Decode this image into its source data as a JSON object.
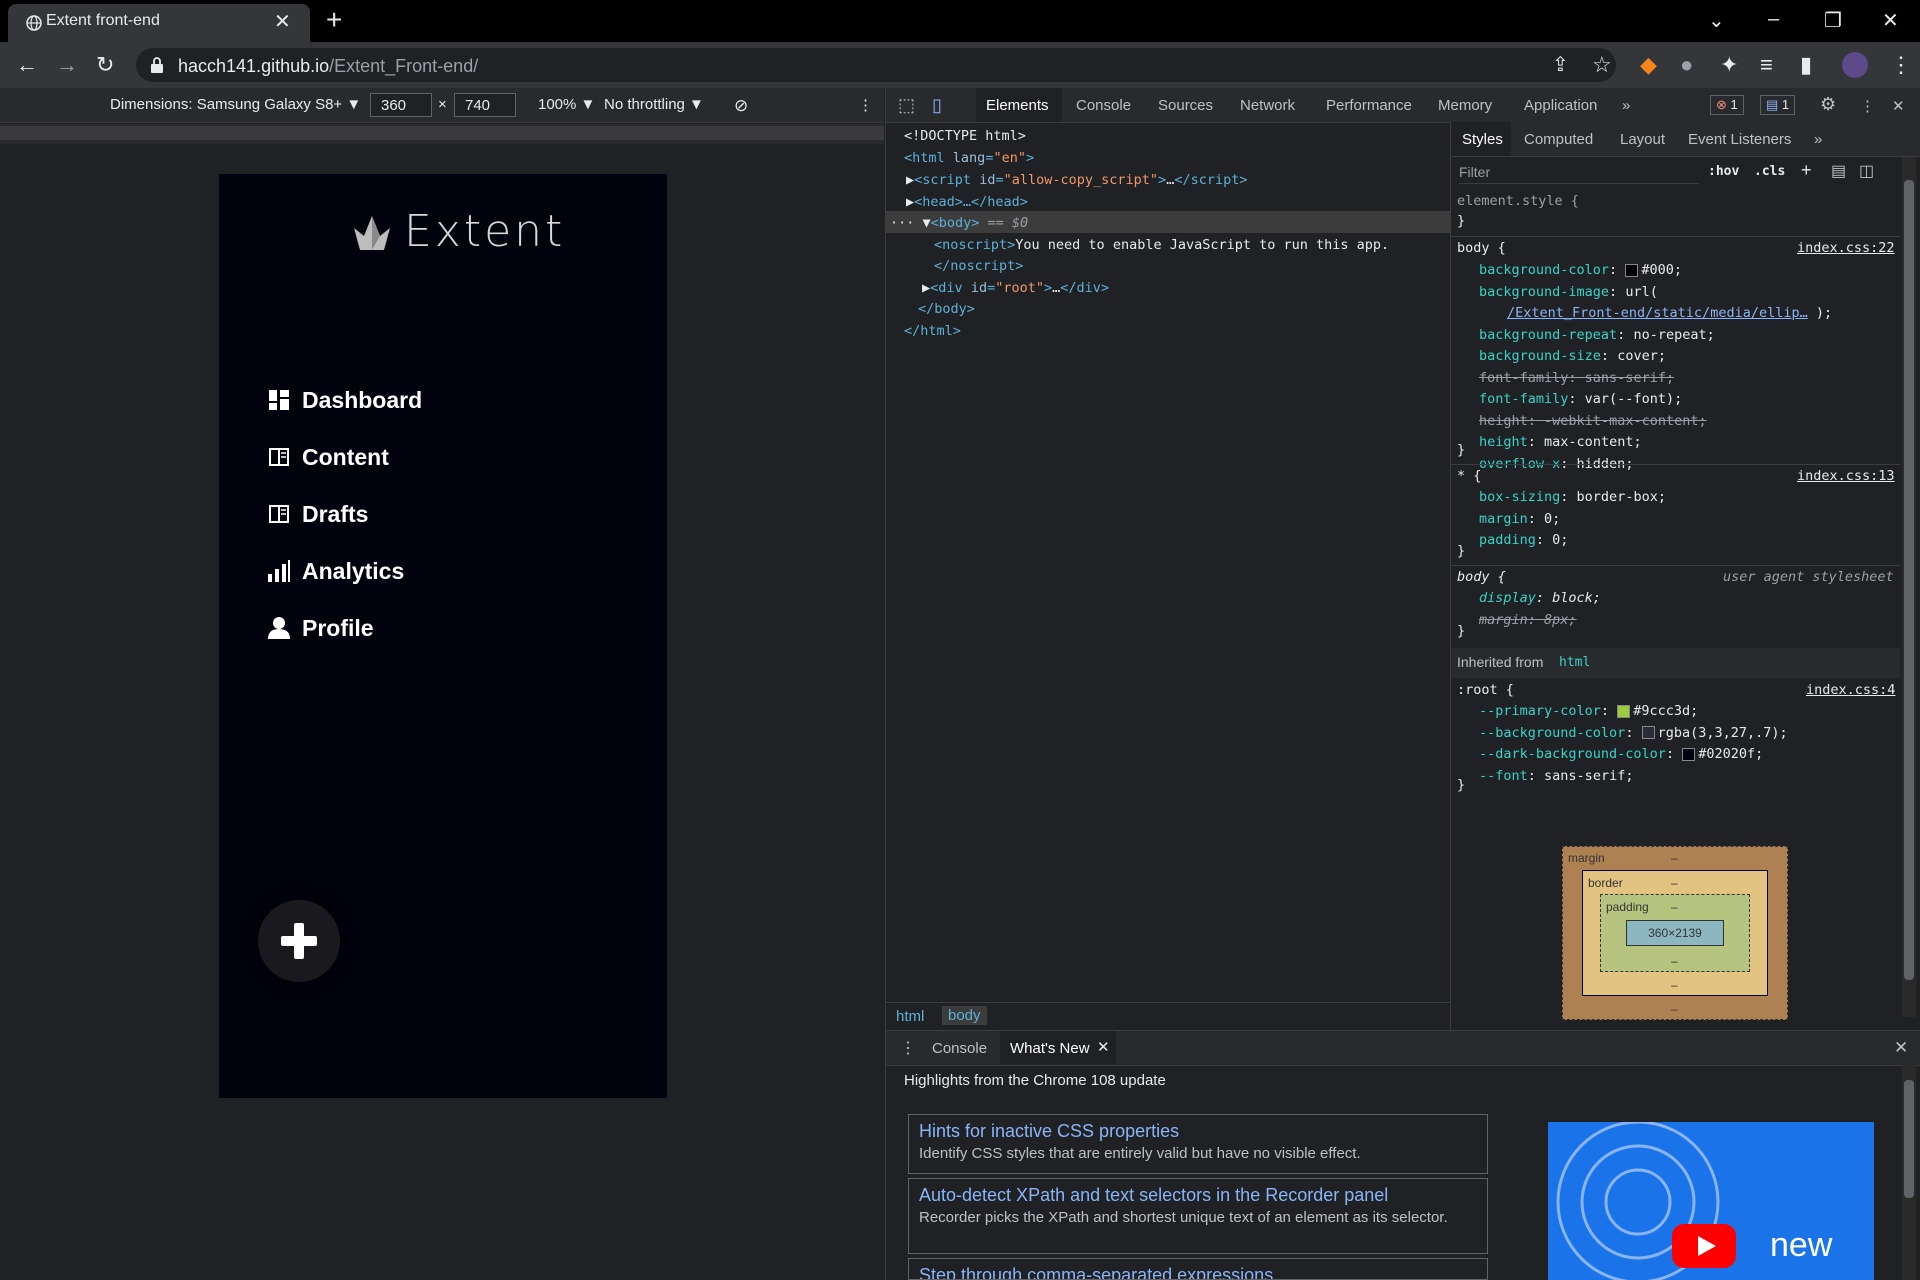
{
  "browser": {
    "tab_title": "Extent front-end",
    "url_host": "hacch141.github.io",
    "url_path": "/Extent_Front-end/"
  },
  "device_toolbar": {
    "dimensions_label": "Dimensions: Samsung Galaxy S8+",
    "width": "360",
    "height": "740",
    "zoom": "100%",
    "throttling": "No throttling"
  },
  "app": {
    "logo_text": "Extent",
    "nav": [
      {
        "label": "Dashboard",
        "icon": "dashboard-icon"
      },
      {
        "label": "Content",
        "icon": "book-icon"
      },
      {
        "label": "Drafts",
        "icon": "book-icon"
      },
      {
        "label": "Analytics",
        "icon": "bar-chart-icon"
      },
      {
        "label": "Profile",
        "icon": "user-icon"
      }
    ],
    "fab_icon": "plus-icon"
  },
  "devtools": {
    "tabs": [
      "Elements",
      "Console",
      "Sources",
      "Network",
      "Performance",
      "Memory",
      "Application"
    ],
    "active_tab": "Elements",
    "error_count": "1",
    "message_count": "1",
    "dom": {
      "doctype": "<!DOCTYPE html>",
      "html_open_tag": "html",
      "html_lang_attr": "lang",
      "html_lang_val": "\"en\"",
      "script_tag": "script",
      "script_id_attr": "id",
      "script_id_val": "\"allow-copy_script\"",
      "head": "<head>…</head>",
      "body_open": "<body>",
      "body_suffix": " == $0",
      "noscript_open": "<noscript>",
      "noscript_text": "You need to enable JavaScript to run this app.",
      "noscript_close": "</noscript>",
      "div_tag": "div",
      "div_id_attr": "id",
      "div_id_val": "\"root\"",
      "body_close": "</body>",
      "html_close": "</html>"
    },
    "breadcrumbs": [
      "html",
      "body"
    ],
    "styles_tabs": [
      "Styles",
      "Computed",
      "Layout",
      "Event Listeners"
    ],
    "filter_placeholder": "Filter",
    "hov": ":hov",
    "cls": ".cls",
    "rules": {
      "element_style": "element.style {",
      "body_selector": "body {",
      "body_source": "index.css:22",
      "body_props": [
        {
          "p": "background-color",
          "v": "#000;",
          "swatch": "#000000"
        },
        {
          "p": "background-image",
          "v": "url("
        },
        {
          "p": "",
          "v": "/Extent_Front-end/static/media/ellip…",
          "link": true
        },
        {
          "p": "background-repeat",
          "v": "no-repeat;"
        },
        {
          "p": "background-size",
          "v": "cover;"
        },
        {
          "p": "font-family",
          "v": "sans-serif;",
          "strike": true
        },
        {
          "p": "font-family",
          "v": "var(--font);"
        },
        {
          "p": "height",
          "v": "-webkit-max-content;",
          "strike": true
        },
        {
          "p": "height",
          "v": "max-content;"
        },
        {
          "p": "overflow-x",
          "v": "hidden;"
        }
      ],
      "star_selector": "* {",
      "star_source": "index.css:13",
      "star_props": [
        {
          "p": "box-sizing",
          "v": "border-box;"
        },
        {
          "p": "margin",
          "v": "0;"
        },
        {
          "p": "padding",
          "v": "0;"
        }
      ],
      "ua_selector": "body {",
      "ua_source": "user agent stylesheet",
      "ua_props": [
        {
          "p": "display",
          "v": "block;"
        },
        {
          "p": "margin",
          "v": "8px;",
          "strike": true
        }
      ],
      "inherited_label": "Inherited from",
      "inherited_from": "html",
      "root_selector": ":root {",
      "root_source": "index.css:4",
      "root_props": [
        {
          "p": "--primary-color",
          "v": "#9ccc3d;",
          "swatch": "#9ccc3d"
        },
        {
          "p": "--background-color",
          "v": "rgba(3,3,27,.7);",
          "swatch": "#2c2c3a"
        },
        {
          "p": "--dark-background-color",
          "v": "#02020f;",
          "swatch": "#02020f"
        },
        {
          "p": "--font",
          "v": "sans-serif;"
        }
      ]
    },
    "box_model": {
      "margin_label": "margin",
      "border_label": "border",
      "padding_label": "padding",
      "content_size": "360×2139",
      "dash": "–"
    }
  },
  "drawer": {
    "tabs": [
      "Console",
      "What's New"
    ],
    "active_tab": "What's New",
    "heading": "Highlights from the Chrome 108 update",
    "cards": [
      {
        "title": "Hints for inactive CSS properties",
        "desc": "Identify CSS styles that are entirely valid but have no visible effect."
      },
      {
        "title": "Auto-detect XPath and text selectors in the Recorder panel",
        "desc": "Recorder picks the XPath and shortest unique text of an element as its selector."
      },
      {
        "title": "Step through comma-separated expressions",
        "desc": ""
      }
    ],
    "promo_text": "new"
  }
}
